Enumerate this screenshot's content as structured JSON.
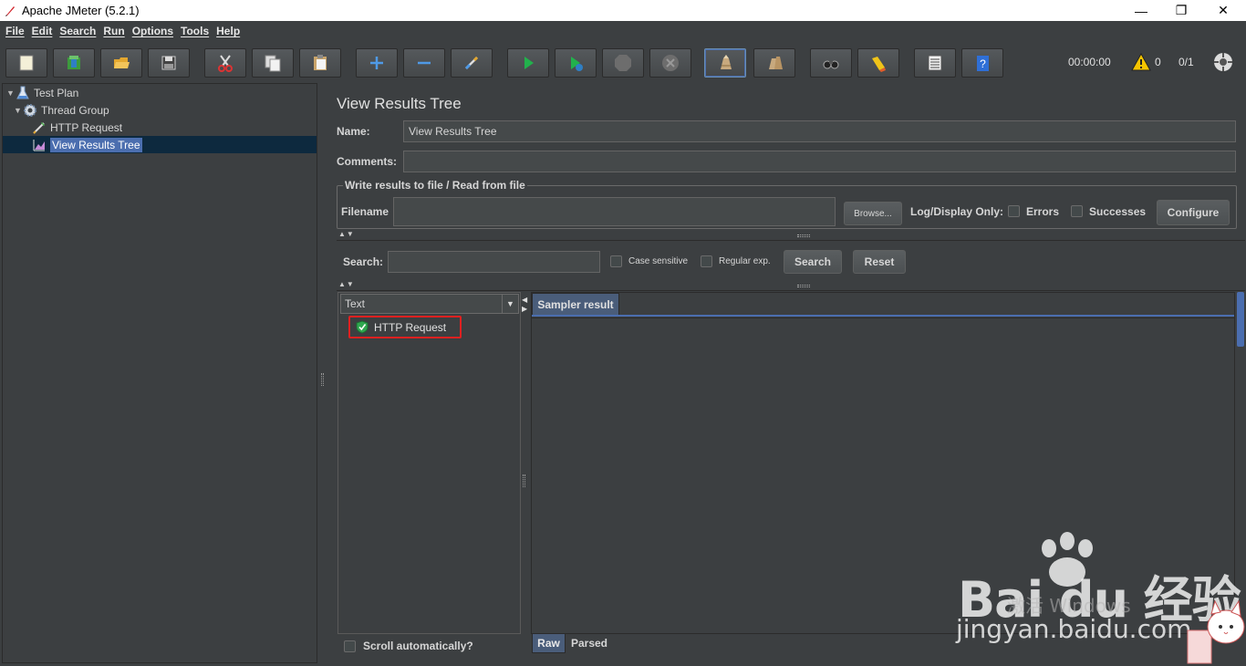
{
  "window": {
    "title": "Apache JMeter (5.2.1)",
    "controls": [
      "minimize-icon",
      "restore-icon",
      "close-icon"
    ],
    "minimize_glyph": "—",
    "restore_glyph": "❐",
    "close_glyph": "✕"
  },
  "menu": [
    "File",
    "Edit",
    "Search",
    "Run",
    "Options",
    "Tools",
    "Help"
  ],
  "toolbar": {
    "buttons": [
      "new-icon",
      "templates-icon",
      "open-icon",
      "save-icon",
      "cut-icon",
      "copy-icon",
      "paste-icon",
      "expand-icon",
      "collapse-icon",
      "toggle-icon",
      "start-icon",
      "start-no-pause-icon",
      "stop-icon",
      "shutdown-icon",
      "clear-icon",
      "clear-all-icon",
      "search-icon",
      "reset-search-icon",
      "function-helper-icon",
      "help-icon"
    ],
    "timer": "00:00:00",
    "warnings": "0",
    "threads": "0/1"
  },
  "tree": {
    "items": [
      {
        "label": "Test Plan",
        "icon": "test-plan-icon"
      },
      {
        "label": "Thread Group",
        "icon": "thread-group-icon"
      },
      {
        "label": "HTTP Request",
        "icon": "http-request-icon"
      },
      {
        "label": "View Results Tree",
        "icon": "view-results-tree-icon"
      }
    ]
  },
  "panel": {
    "title": "View Results Tree",
    "name_label": "Name:",
    "name_value": "View Results Tree",
    "comments_label": "Comments:",
    "comments_value": "",
    "file_group_title": "Write results to file / Read from file",
    "filename_label": "Filename",
    "filename_value": "",
    "browse_label": "Browse...",
    "log_display_label": "Log/Display Only:",
    "errors_label": "Errors",
    "successes_label": "Successes",
    "configure_label": "Configure",
    "search_label": "Search:",
    "search_value": "",
    "case_sensitive_label": "Case sensitive",
    "regular_exp_label": "Regular exp.",
    "search_button": "Search",
    "reset_button": "Reset"
  },
  "results": {
    "renderer": "Text",
    "items": [
      {
        "label": "HTTP Request",
        "status": "success"
      }
    ],
    "sampler_tab": "Sampler result",
    "scroll_auto_label": "Scroll automatically?",
    "bottom_tabs": [
      "Raw",
      "Parsed"
    ],
    "arrows": "▲▼"
  },
  "watermark": {
    "brand": "Bai  du 经验",
    "url": "jingyan.baidu.com",
    "activation": "激活 Windows"
  },
  "colors": {
    "background": "#3c3f41",
    "selection": "#4b6eaf",
    "highlight_box": "#e02020",
    "tab_active": "#4a5d7a"
  }
}
